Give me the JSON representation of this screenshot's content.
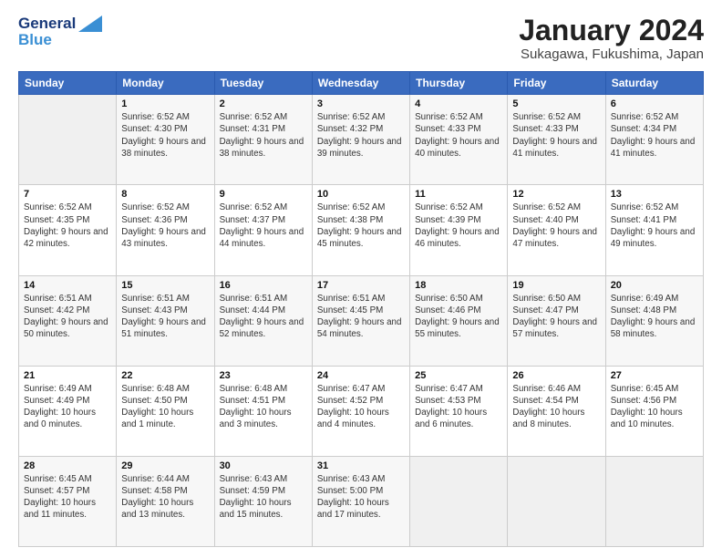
{
  "header": {
    "logo_line1": "General",
    "logo_line2": "Blue",
    "month_title": "January 2024",
    "location": "Sukagawa, Fukushima, Japan"
  },
  "weekdays": [
    "Sunday",
    "Monday",
    "Tuesday",
    "Wednesday",
    "Thursday",
    "Friday",
    "Saturday"
  ],
  "weeks": [
    [
      {
        "day": "",
        "sunrise": "",
        "sunset": "",
        "daylight": ""
      },
      {
        "day": "1",
        "sunrise": "Sunrise: 6:52 AM",
        "sunset": "Sunset: 4:30 PM",
        "daylight": "Daylight: 9 hours and 38 minutes."
      },
      {
        "day": "2",
        "sunrise": "Sunrise: 6:52 AM",
        "sunset": "Sunset: 4:31 PM",
        "daylight": "Daylight: 9 hours and 38 minutes."
      },
      {
        "day": "3",
        "sunrise": "Sunrise: 6:52 AM",
        "sunset": "Sunset: 4:32 PM",
        "daylight": "Daylight: 9 hours and 39 minutes."
      },
      {
        "day": "4",
        "sunrise": "Sunrise: 6:52 AM",
        "sunset": "Sunset: 4:33 PM",
        "daylight": "Daylight: 9 hours and 40 minutes."
      },
      {
        "day": "5",
        "sunrise": "Sunrise: 6:52 AM",
        "sunset": "Sunset: 4:33 PM",
        "daylight": "Daylight: 9 hours and 41 minutes."
      },
      {
        "day": "6",
        "sunrise": "Sunrise: 6:52 AM",
        "sunset": "Sunset: 4:34 PM",
        "daylight": "Daylight: 9 hours and 41 minutes."
      }
    ],
    [
      {
        "day": "7",
        "sunrise": "Sunrise: 6:52 AM",
        "sunset": "Sunset: 4:35 PM",
        "daylight": "Daylight: 9 hours and 42 minutes."
      },
      {
        "day": "8",
        "sunrise": "Sunrise: 6:52 AM",
        "sunset": "Sunset: 4:36 PM",
        "daylight": "Daylight: 9 hours and 43 minutes."
      },
      {
        "day": "9",
        "sunrise": "Sunrise: 6:52 AM",
        "sunset": "Sunset: 4:37 PM",
        "daylight": "Daylight: 9 hours and 44 minutes."
      },
      {
        "day": "10",
        "sunrise": "Sunrise: 6:52 AM",
        "sunset": "Sunset: 4:38 PM",
        "daylight": "Daylight: 9 hours and 45 minutes."
      },
      {
        "day": "11",
        "sunrise": "Sunrise: 6:52 AM",
        "sunset": "Sunset: 4:39 PM",
        "daylight": "Daylight: 9 hours and 46 minutes."
      },
      {
        "day": "12",
        "sunrise": "Sunrise: 6:52 AM",
        "sunset": "Sunset: 4:40 PM",
        "daylight": "Daylight: 9 hours and 47 minutes."
      },
      {
        "day": "13",
        "sunrise": "Sunrise: 6:52 AM",
        "sunset": "Sunset: 4:41 PM",
        "daylight": "Daylight: 9 hours and 49 minutes."
      }
    ],
    [
      {
        "day": "14",
        "sunrise": "Sunrise: 6:51 AM",
        "sunset": "Sunset: 4:42 PM",
        "daylight": "Daylight: 9 hours and 50 minutes."
      },
      {
        "day": "15",
        "sunrise": "Sunrise: 6:51 AM",
        "sunset": "Sunset: 4:43 PM",
        "daylight": "Daylight: 9 hours and 51 minutes."
      },
      {
        "day": "16",
        "sunrise": "Sunrise: 6:51 AM",
        "sunset": "Sunset: 4:44 PM",
        "daylight": "Daylight: 9 hours and 52 minutes."
      },
      {
        "day": "17",
        "sunrise": "Sunrise: 6:51 AM",
        "sunset": "Sunset: 4:45 PM",
        "daylight": "Daylight: 9 hours and 54 minutes."
      },
      {
        "day": "18",
        "sunrise": "Sunrise: 6:50 AM",
        "sunset": "Sunset: 4:46 PM",
        "daylight": "Daylight: 9 hours and 55 minutes."
      },
      {
        "day": "19",
        "sunrise": "Sunrise: 6:50 AM",
        "sunset": "Sunset: 4:47 PM",
        "daylight": "Daylight: 9 hours and 57 minutes."
      },
      {
        "day": "20",
        "sunrise": "Sunrise: 6:49 AM",
        "sunset": "Sunset: 4:48 PM",
        "daylight": "Daylight: 9 hours and 58 minutes."
      }
    ],
    [
      {
        "day": "21",
        "sunrise": "Sunrise: 6:49 AM",
        "sunset": "Sunset: 4:49 PM",
        "daylight": "Daylight: 10 hours and 0 minutes."
      },
      {
        "day": "22",
        "sunrise": "Sunrise: 6:48 AM",
        "sunset": "Sunset: 4:50 PM",
        "daylight": "Daylight: 10 hours and 1 minute."
      },
      {
        "day": "23",
        "sunrise": "Sunrise: 6:48 AM",
        "sunset": "Sunset: 4:51 PM",
        "daylight": "Daylight: 10 hours and 3 minutes."
      },
      {
        "day": "24",
        "sunrise": "Sunrise: 6:47 AM",
        "sunset": "Sunset: 4:52 PM",
        "daylight": "Daylight: 10 hours and 4 minutes."
      },
      {
        "day": "25",
        "sunrise": "Sunrise: 6:47 AM",
        "sunset": "Sunset: 4:53 PM",
        "daylight": "Daylight: 10 hours and 6 minutes."
      },
      {
        "day": "26",
        "sunrise": "Sunrise: 6:46 AM",
        "sunset": "Sunset: 4:54 PM",
        "daylight": "Daylight: 10 hours and 8 minutes."
      },
      {
        "day": "27",
        "sunrise": "Sunrise: 6:45 AM",
        "sunset": "Sunset: 4:56 PM",
        "daylight": "Daylight: 10 hours and 10 minutes."
      }
    ],
    [
      {
        "day": "28",
        "sunrise": "Sunrise: 6:45 AM",
        "sunset": "Sunset: 4:57 PM",
        "daylight": "Daylight: 10 hours and 11 minutes."
      },
      {
        "day": "29",
        "sunrise": "Sunrise: 6:44 AM",
        "sunset": "Sunset: 4:58 PM",
        "daylight": "Daylight: 10 hours and 13 minutes."
      },
      {
        "day": "30",
        "sunrise": "Sunrise: 6:43 AM",
        "sunset": "Sunset: 4:59 PM",
        "daylight": "Daylight: 10 hours and 15 minutes."
      },
      {
        "day": "31",
        "sunrise": "Sunrise: 6:43 AM",
        "sunset": "Sunset: 5:00 PM",
        "daylight": "Daylight: 10 hours and 17 minutes."
      },
      {
        "day": "",
        "sunrise": "",
        "sunset": "",
        "daylight": ""
      },
      {
        "day": "",
        "sunrise": "",
        "sunset": "",
        "daylight": ""
      },
      {
        "day": "",
        "sunrise": "",
        "sunset": "",
        "daylight": ""
      }
    ]
  ]
}
